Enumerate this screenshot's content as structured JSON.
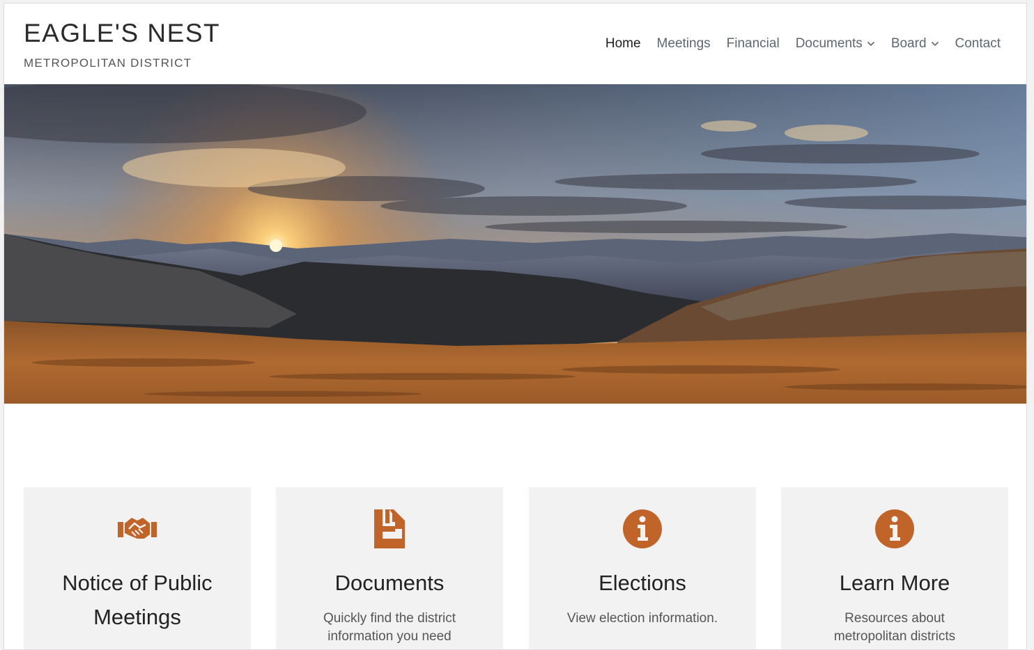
{
  "header": {
    "title": "EAGLE'S NEST",
    "subtitle": "METROPOLITAN DISTRICT"
  },
  "nav": {
    "items": [
      {
        "label": "Home",
        "active": true,
        "dropdown": false
      },
      {
        "label": "Meetings",
        "active": false,
        "dropdown": false
      },
      {
        "label": "Financial",
        "active": false,
        "dropdown": false
      },
      {
        "label": "Documents",
        "active": false,
        "dropdown": true
      },
      {
        "label": "Board",
        "active": false,
        "dropdown": true
      },
      {
        "label": "Contact",
        "active": false,
        "dropdown": false
      }
    ]
  },
  "hero": {
    "image": "mountain-sunset-panorama"
  },
  "cards": [
    {
      "icon": "handshake-icon",
      "title": "Notice of Public Meetings",
      "text": ""
    },
    {
      "icon": "document-icon",
      "title": "Documents",
      "text": "Quickly find the district information you need"
    },
    {
      "icon": "info-circle-icon",
      "title": "Elections",
      "text": "View election information."
    },
    {
      "icon": "info-circle-icon",
      "title": "Learn More",
      "text": "Resources about metropolitan districts"
    }
  ],
  "colors": {
    "accent": "#c0642a",
    "card_bg": "#f2f2f2",
    "nav_text": "#5f6670",
    "nav_active": "#1e1e1e"
  }
}
